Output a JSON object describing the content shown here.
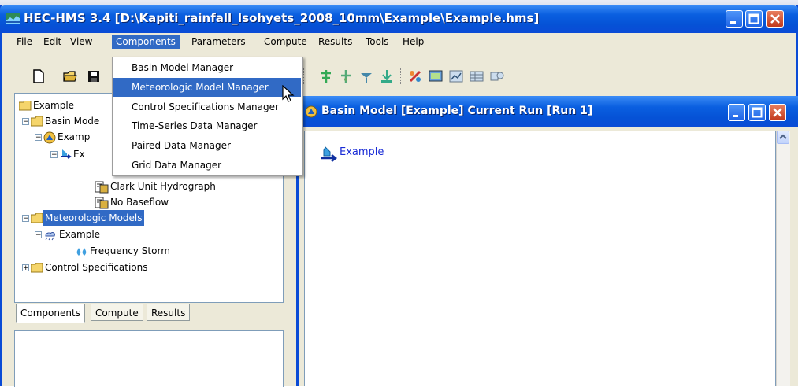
{
  "window": {
    "title": "HEC-HMS 3.4 [D:\\Kapiti_rainfall_Isohyets_2008_10mm\\Example\\Example.hms]"
  },
  "menu": [
    "File",
    "Edit",
    "View",
    "Components",
    "Parameters",
    "Compute",
    "Results",
    "Tools",
    "Help"
  ],
  "components_menu": {
    "items": [
      "Basin Model Manager",
      "Meteorologic Model Manager",
      "Control Specifications Manager",
      "Time-Series Data Manager",
      "Paired Data Manager",
      "Grid Data Manager"
    ],
    "highlighted": "Meteorologic Model Manager"
  },
  "tree": {
    "root": "Example",
    "basin_models": "Basin Mode",
    "basin_example": "Examp",
    "subbasin": "Ex",
    "transform": "Clark Unit Hydrograph",
    "baseflow": "No Baseflow",
    "met_models": "Meteorologic Models",
    "met_example": "Example",
    "frequency_storm": "Frequency Storm",
    "control_specs": "Control Specifications"
  },
  "panel_tabs": [
    "Components",
    "Compute",
    "Results"
  ],
  "inner_window": {
    "title": "Basin Model [Example]  Current Run [Run 1]"
  },
  "canvas": {
    "element_label": "Example"
  },
  "colors": {
    "title_bar": "#0a5fe0",
    "selection": "#316ac5",
    "link_text": "#1a2cd6"
  }
}
